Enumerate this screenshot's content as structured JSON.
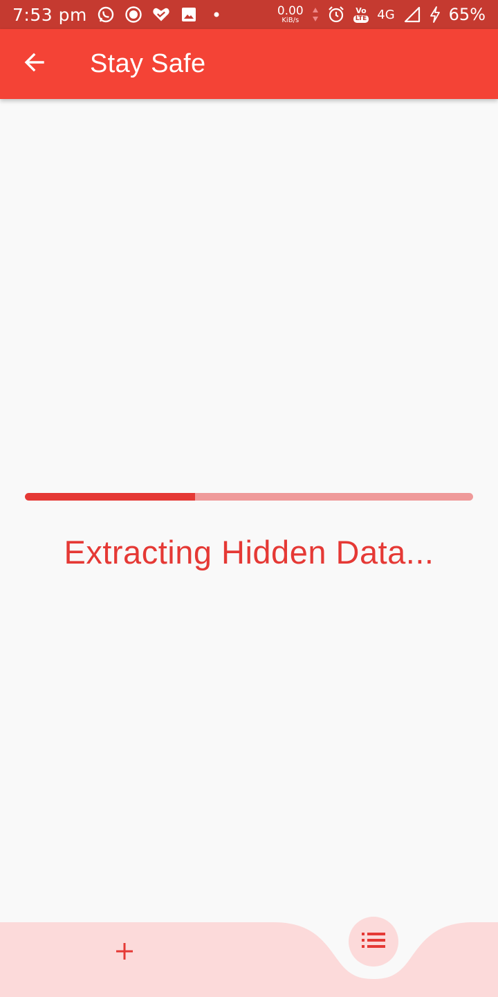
{
  "status_bar": {
    "time": "7:53 pm",
    "net_speed_value": "0.00",
    "net_speed_unit": "KiB/s",
    "volte_label": "Vo",
    "lte_label": "LTE",
    "network_type": "4G",
    "battery": "65%",
    "icons": [
      "whatsapp-icon",
      "record-icon",
      "heart-check-icon",
      "image-icon",
      "dot-icon",
      "data-arrows-icon",
      "alarm-icon",
      "volte-icon",
      "signal-icon",
      "charging-icon"
    ]
  },
  "app_bar": {
    "title": "Stay Safe",
    "back_icon": "arrow-back-icon"
  },
  "main": {
    "progress": 0.38,
    "status_text": "Extracting Hidden Data..."
  },
  "bottom_nav": {
    "add_icon": "plus-icon",
    "list_icon": "list-icon"
  },
  "colors": {
    "status_bar": "#c53a30",
    "app_bar": "#f44336",
    "accent": "#e53935",
    "progress_track": "#ef9a9a",
    "bottom_nav": "#fcdada",
    "background": "#f9f9f9"
  }
}
